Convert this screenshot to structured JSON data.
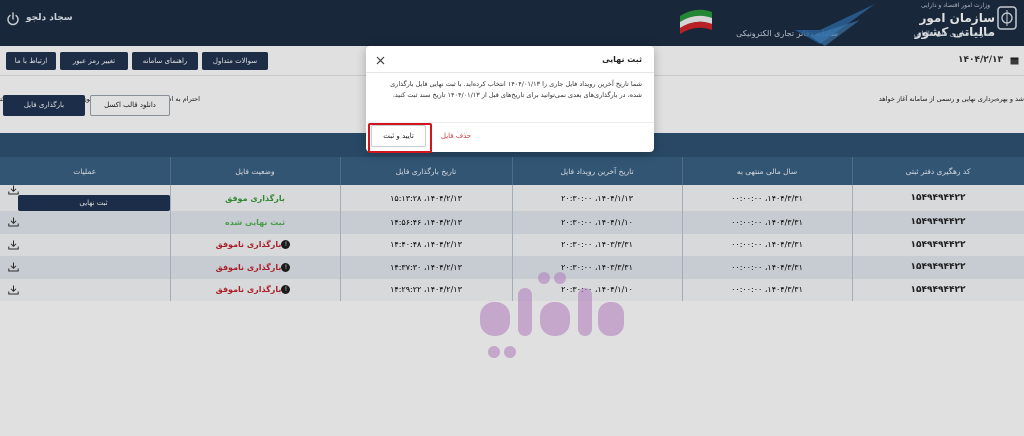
{
  "header": {
    "username": "سجاد دلجو",
    "system_title": "سامانه دفاتر تجاری الکترونیکی",
    "org_small": "وزارت امور اقتصاد و دارایی",
    "org_main": "سازمان امور مالیاتی کشور",
    "org_sub": "معاونت فناوری های مالیاتی"
  },
  "nav": {
    "contact": "ارتباط با ما",
    "change_password": "تغییر رمز عبور",
    "guide": "راهنمای سامانه",
    "faq": "سوالات متداول",
    "date": "۱۴۰۴/۲/۱۳"
  },
  "notice": {
    "left_text": "احترام به اطلاع میرساند دوره استفاده آموزشی از سامانه دفاتر تجاری الکترونیکی از ابتدای اردیبهشت ۱۴۰۴ تا ۱۷ اردیبهشت",
    "right_text": "شد و بهره‌برداری نهایی و رسمی از سامانه آغاز خواهد"
  },
  "actions": {
    "upload_file": "بارگذاری فایل",
    "download_template": "دانلود قالب اکسل"
  },
  "table": {
    "columns": [
      "کد رهگیری دفتر ثبتی",
      "سال مالی منتهی به",
      "تاریخ آخرین رویداد فایل",
      "تاریخ بارگذاری فایل",
      "وضعیت فایل",
      "عملیات"
    ],
    "final_button": "ثبت نهایی",
    "rows": [
      {
        "code": "۱۵۴۹۴۹۴۴۲۲",
        "fiscal": "۱۴۰۴/۳/۳۱، ۰۰:۰۰:۰۰",
        "last_event": "۱۴۰۴/۱/۱۳، ۲۰:۳۰:۰۰",
        "upload": "۱۴۰۴/۲/۱۳، ۱۵:۱۳:۲۸",
        "status": "بارگذاری موفق",
        "status_type": "ok",
        "has_final": true
      },
      {
        "code": "۱۵۴۹۴۹۴۴۲۲",
        "fiscal": "۱۴۰۴/۳/۳۱، ۰۰:۰۰:۰۰",
        "last_event": "۱۴۰۴/۱/۱۰، ۲۰:۳۰:۰۰",
        "upload": "۱۴۰۴/۲/۱۳، ۱۴:۵۶:۴۶",
        "status": "ثبت نهایی شده",
        "status_type": "ok",
        "has_final": false
      },
      {
        "code": "۱۵۴۹۴۹۴۴۲۲",
        "fiscal": "۱۴۰۴/۳/۳۱، ۰۰:۰۰:۰۰",
        "last_event": "۱۴۰۳/۳/۳۱، ۲۰:۳۰:۰۰",
        "upload": "۱۴۰۴/۲/۱۳، ۱۴:۴۰:۴۸",
        "status": "بارگذاری ناموفق",
        "status_type": "fail",
        "has_final": false
      },
      {
        "code": "۱۵۴۹۴۹۴۴۲۲",
        "fiscal": "۱۴۰۴/۳/۳۱، ۰۰:۰۰:۰۰",
        "last_event": "۱۴۰۳/۳/۳۱، ۲۰:۳۰:۰۰",
        "upload": "۱۴۰۴/۲/۱۳، ۱۴:۳۷:۳۰",
        "status": "بارگذاری ناموفق",
        "status_type": "fail",
        "has_final": false
      },
      {
        "code": "۱۵۴۹۴۹۴۴۲۲",
        "fiscal": "۱۴۰۴/۳/۳۱، ۰۰:۰۰:۰۰",
        "last_event": "۱۴۰۴/۱/۱۰، ۲۰:۳۰:۰۰",
        "upload": "۱۴۰۴/۲/۱۳، ۱۴:۲۹:۲۲",
        "status": "بارگذاری ناموفق",
        "status_type": "fail",
        "has_final": false
      }
    ]
  },
  "modal": {
    "title": "ثبت نهایی",
    "body": "شما تاریخ آخرین رویداد فایل جاری را ۱۴۰۴/۰۱/۱۳ انتخاب کرده‌اید. با ثبت نهایی فایل بارگذاری شده، در بارگذاری‌های بعدی نمی‌توانید برای تاریخ‌های قبل از ۱۴۰۴/۰۱/۱۳ تاریخ سند ثبت کنید.",
    "confirm": "تایید و ثبت",
    "delete": "حذف فایل"
  },
  "colors": {
    "header_bg": "#1d2d44",
    "table_header": "#3a6185",
    "success": "#3b9b3b",
    "error": "#c0262f",
    "highlight": "#d4141c"
  },
  "icons": {
    "power": "power-icon",
    "close": "close-icon",
    "download": "download-icon",
    "info": "info-icon",
    "calendar": "calendar-icon"
  }
}
